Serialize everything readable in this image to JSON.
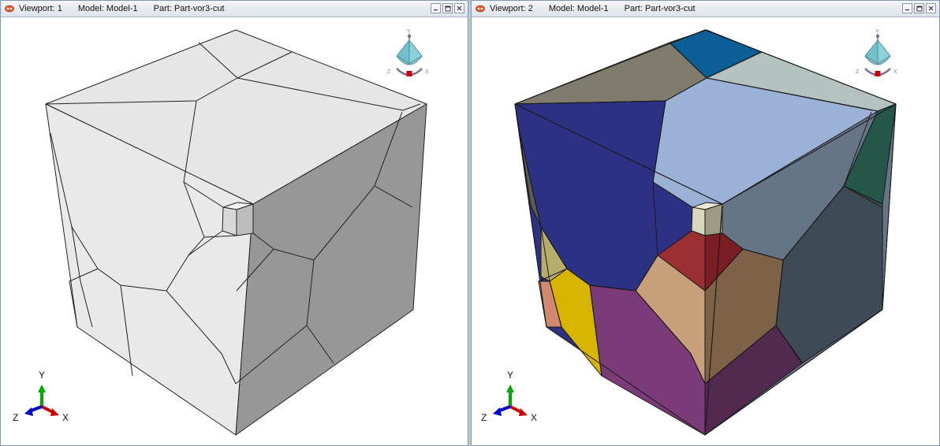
{
  "viewports": [
    {
      "title_prefix": "Viewport: 1",
      "model_label": "Model: Model-1",
      "part_label": "Part: Part-vor3-cut",
      "render_mode": "grey"
    },
    {
      "title_prefix": "Viewport: 2",
      "model_label": "Model: Model-1",
      "part_label": "Part: Part-vor3-cut",
      "render_mode": "color"
    }
  ],
  "triad": {
    "x_label": "X",
    "y_label": "Y",
    "z_label": "Z"
  },
  "view_cube": {
    "x_label": "X",
    "y_label": "Y",
    "z_label": "Z"
  },
  "icons": {
    "viewport_icon": "abaqus-eye-icon",
    "minimize": "minimize-icon",
    "restore": "restore-icon",
    "close": "close-icon"
  },
  "colors": {
    "triad_x": "#cc0000",
    "triad_y": "#00aa00",
    "triad_z": "#0000cc"
  }
}
